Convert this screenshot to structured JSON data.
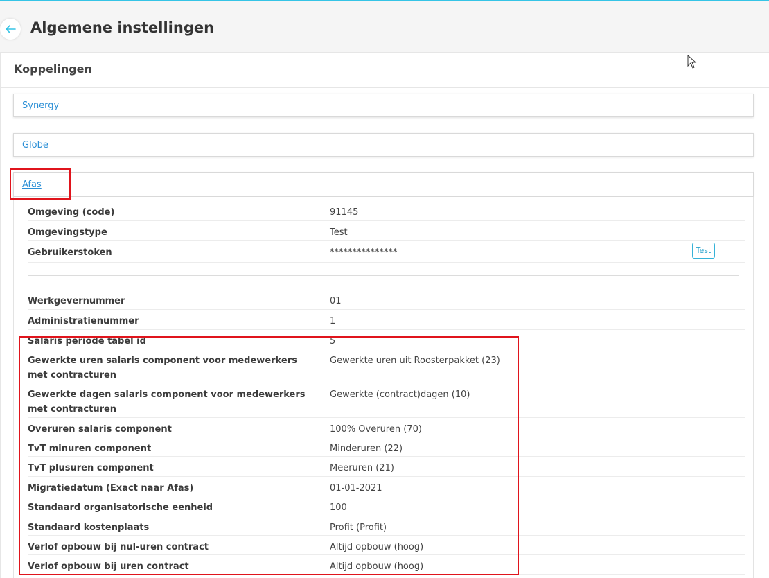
{
  "header": {
    "title": "Algemene instellingen",
    "back_icon": "arrow-left-icon"
  },
  "section": {
    "title": "Koppelingen"
  },
  "panels": [
    {
      "label": "Synergy"
    },
    {
      "label": "Globe"
    },
    {
      "label": "Afas"
    }
  ],
  "afas": {
    "settings": [
      {
        "label": "Omgeving (code)",
        "value": "91145"
      },
      {
        "label": "Omgevingstype",
        "value": "Test"
      },
      {
        "label": "Gebruikerstoken",
        "value": "***************"
      }
    ],
    "test_button": "Test",
    "rows": [
      {
        "label": "Werkgevernummer",
        "value": "01"
      },
      {
        "label": "Administratienummer",
        "value": "1"
      },
      {
        "label": "Salaris periode tabel id",
        "value": "5"
      },
      {
        "label": "Gewerkte uren salaris component voor medewerkers met contracturen",
        "value": "Gewerkte uren uit Roosterpakket (23)"
      },
      {
        "label": "Gewerkte dagen salaris component voor medewerkers met contracturen",
        "value": "Gewerkte (contract)dagen (10)"
      },
      {
        "label": "Overuren salaris component",
        "value": "100% Overuren (70)"
      },
      {
        "label": "TvT minuren component",
        "value": "Minderuren (22)"
      },
      {
        "label": "TvT plusuren component",
        "value": "Meeruren (21)"
      },
      {
        "label": "Migratiedatum (Exact naar Afas)",
        "value": "01-01-2021"
      },
      {
        "label": "Standaard organisatorische eenheid",
        "value": "100"
      },
      {
        "label": "Standaard kostenplaats",
        "value": "Profit (Profit)"
      },
      {
        "label": "Verlof opbouw bij nul-uren contract",
        "value": "Altijd opbouw (hoog)"
      },
      {
        "label": "Verlof opbouw bij uren contract",
        "value": "Altijd opbouw (hoog)"
      }
    ]
  },
  "colors": {
    "accent": "#35c4e6",
    "link": "#2b8fd6",
    "highlight": "#e0141c"
  }
}
